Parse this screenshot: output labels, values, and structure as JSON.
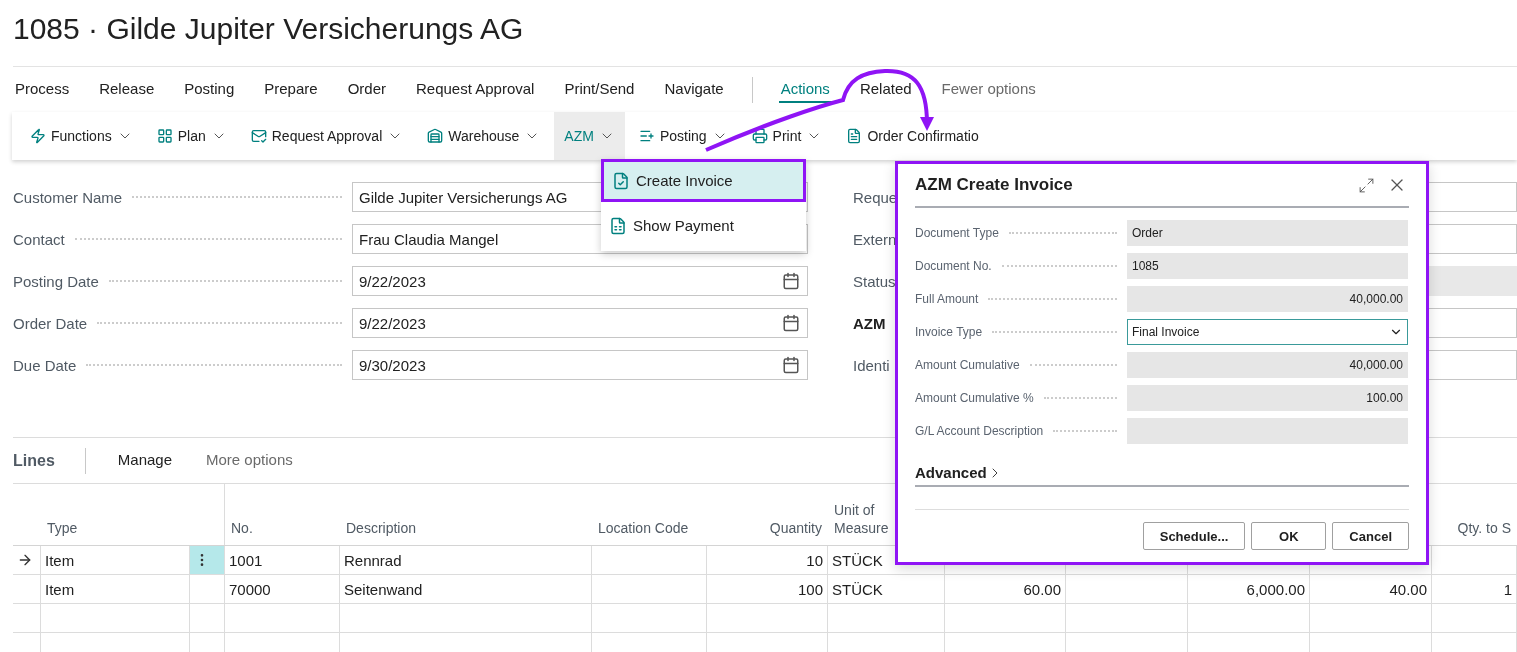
{
  "page_title": "1085 · Gilde Jupiter Versicherungs AG",
  "nav_menu": [
    "Process",
    "Release",
    "Posting",
    "Prepare",
    "Order",
    "Request Approval",
    "Print/Send",
    "Navigate"
  ],
  "nav_views": [
    {
      "label": "Actions",
      "selected": true
    },
    {
      "label": "Related",
      "selected": false
    }
  ],
  "fewer_options": "Fewer options",
  "action_bar": [
    {
      "label": "Functions",
      "has_menu": true,
      "open": false
    },
    {
      "label": "Plan",
      "has_menu": true,
      "open": false
    },
    {
      "label": "Request Approval",
      "has_menu": true,
      "open": false
    },
    {
      "label": "Warehouse",
      "has_menu": true,
      "open": false
    },
    {
      "label": "AZM",
      "has_menu": true,
      "open": true
    },
    {
      "label": "Posting",
      "has_menu": true,
      "open": false
    },
    {
      "label": "Print",
      "has_menu": true,
      "open": false
    },
    {
      "label": "Order Confirmatio",
      "has_menu": false,
      "open": false
    }
  ],
  "azm_menu": [
    {
      "label": "Create Invoice",
      "selected": true,
      "highlighted": true
    },
    {
      "label": "Show Payment",
      "selected": false,
      "highlighted": false
    }
  ],
  "general_left": [
    {
      "label": "Customer Name",
      "value": "Gilde Jupiter Versicherungs AG",
      "kind": "text"
    },
    {
      "label": "Contact",
      "value": "Frau Claudia Mangel",
      "kind": "text"
    },
    {
      "label": "Posting Date",
      "value": "9/22/2023",
      "kind": "date"
    },
    {
      "label": "Order Date",
      "value": "9/22/2023",
      "kind": "date"
    },
    {
      "label": "Due Date",
      "value": "9/30/2023",
      "kind": "date"
    }
  ],
  "general_right": [
    {
      "label": "Reque",
      "bold": false,
      "kind": "text"
    },
    {
      "label": "Extern",
      "bold": false,
      "kind": "text"
    },
    {
      "label": "Status",
      "bold": false,
      "kind": "readonly"
    },
    {
      "label": "AZM",
      "bold": true,
      "kind": "text"
    },
    {
      "label": "Identi",
      "bold": false,
      "kind": "text"
    }
  ],
  "lines": {
    "title": "Lines",
    "actions": [
      {
        "label": "Manage",
        "muted": false
      },
      {
        "label": "More options",
        "muted": true
      }
    ],
    "columns": [
      {
        "header": "Type"
      },
      {
        "header": "No."
      },
      {
        "header": "Description"
      },
      {
        "header": "Location Code"
      },
      {
        "header": "Quantity"
      },
      {
        "header": "Unit of Measure"
      },
      {},
      {},
      {},
      {},
      {
        "header": "Qty. to S"
      }
    ],
    "rows": [
      {
        "current": true,
        "cells": [
          "Item",
          "1001",
          "Rennrad",
          null,
          "10",
          "STÜCK",
          null,
          null,
          null,
          null,
          null
        ]
      },
      {
        "current": false,
        "cells": [
          "Item",
          "70000",
          "Seitenwand",
          null,
          "100",
          "STÜCK",
          "60.00",
          null,
          "6,000.00",
          "40.00",
          "1"
        ]
      }
    ]
  },
  "dialog": {
    "title": "AZM Create Invoice",
    "highlighted": true,
    "fields": [
      {
        "label": "Document Type",
        "value": "Order",
        "kind": "text"
      },
      {
        "label": "Document No.",
        "value": "1085",
        "kind": "text"
      },
      {
        "label": "Full Amount",
        "value": "40,000.00",
        "kind": "number"
      },
      {
        "label": "Invoice Type",
        "value": "Final Invoice",
        "kind": "select"
      },
      {
        "label": "Amount Cumulative",
        "value": "40,000.00",
        "kind": "number"
      },
      {
        "label": "Amount Cumulative %",
        "value": "100.00",
        "kind": "number"
      },
      {
        "label": "G/L Account Description",
        "kind": "text"
      }
    ],
    "advanced": {
      "label": "Advanced",
      "expanded": false
    },
    "buttons": [
      "Schedule...",
      "OK",
      "Cancel"
    ]
  },
  "annotation_arrow": true
}
